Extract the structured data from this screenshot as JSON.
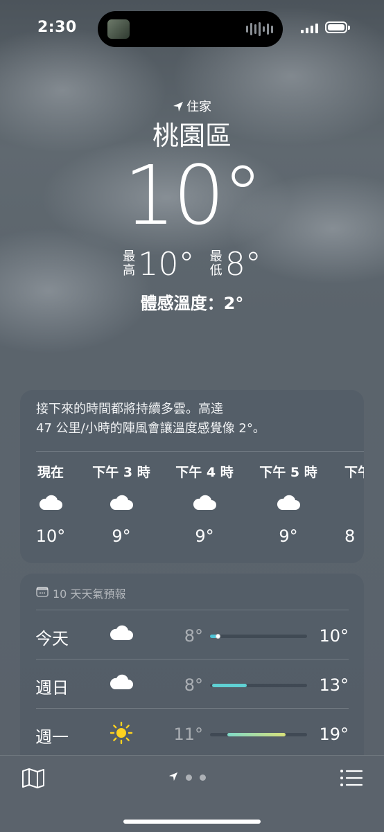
{
  "status_bar": {
    "time": "2:30"
  },
  "location": {
    "label": "住家",
    "city": "桃園區",
    "temperature": "10°",
    "high_label": [
      "最",
      "高"
    ],
    "high": "10°",
    "low_label": [
      "最",
      "低"
    ],
    "low": "8°",
    "feels_like": "體感溫度：2°"
  },
  "hourly": {
    "summary_line1": "接下來的時間都將持續多雲。高達",
    "summary_line2": "47 公里/小時的陣風會讓溫度感覺像 2°。",
    "hours": [
      {
        "label": "現在",
        "icon": "cloud-icon",
        "temp": "10°"
      },
      {
        "label": "下午 3 時",
        "icon": "cloud-icon",
        "temp": "9°"
      },
      {
        "label": "下午 4 時",
        "icon": "cloud-icon",
        "temp": "9°"
      },
      {
        "label": "下午 5 時",
        "icon": "cloud-icon",
        "temp": "9°"
      },
      {
        "label": "下午",
        "icon": "cloud-icon",
        "temp": "8"
      }
    ]
  },
  "forecast": {
    "title": "10 天天氣預報",
    "range_fraction_min_max_note": "bar positions given as fraction of track",
    "days": [
      {
        "day": "今天",
        "icon": "cloud-icon",
        "low": "8°",
        "high": "10°",
        "bar_start": 0.0,
        "bar_end": 0.08,
        "bar_color": "#4fc3d6",
        "current_fraction": 0.08
      },
      {
        "day": "週日",
        "icon": "cloud-icon",
        "low": "8°",
        "high": "13°",
        "bar_start": 0.02,
        "bar_end": 0.38,
        "bar_color": "#5fd0d3"
      },
      {
        "day": "週一",
        "icon": "sun-icon",
        "low": "11°",
        "high": "19°",
        "bar_start": 0.18,
        "bar_end": 0.78,
        "bar_color": "linear-gradient(90deg,#7fd9c8,#d8e07a)"
      }
    ]
  },
  "bottom_bar": {
    "map": "map-icon",
    "list": "list-icon"
  }
}
